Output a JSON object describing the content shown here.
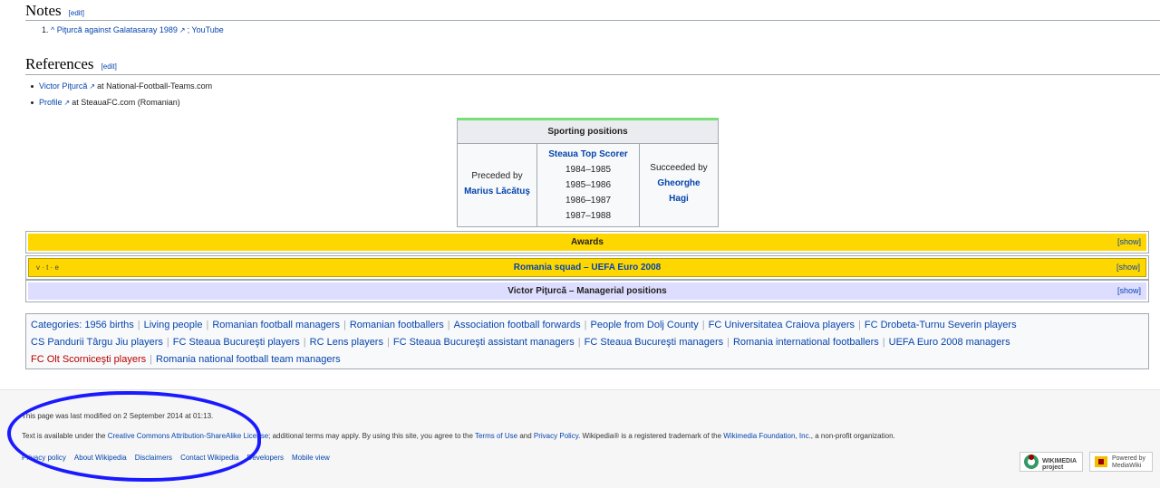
{
  "notes": {
    "heading": "Notes",
    "edit": "[edit]",
    "items": [
      {
        "num": "1.",
        "caret": "^",
        "link": "Piţurcă against Galatasaray 1989",
        "suffix": "; YouTube"
      }
    ]
  },
  "references": {
    "heading": "References",
    "edit": "[edit]",
    "items": [
      {
        "link": "Victor Piţurcă",
        "suffix": "at National-Football-Teams.com"
      },
      {
        "link": "Profile",
        "suffix": "at SteauaFC.com (Romanian)"
      }
    ]
  },
  "succession": {
    "title": "Sporting positions",
    "preceded_label": "Preceded by",
    "preceded_name": "Marius Lăcătuş",
    "position": "Steaua Top Scorer",
    "years": [
      "1984–1985",
      "1985–1986",
      "1986–1987",
      "1987–1988"
    ],
    "succeeded_label": "Succeeded by",
    "succeeded_name_1": "Gheorghe",
    "succeeded_name_2": "Hagi"
  },
  "navboxes": [
    {
      "title": "Awards",
      "show": "[show]",
      "color": "#ffd700"
    },
    {
      "title": "Romania squad – UEFA Euro 2008",
      "show": "[show]",
      "vte": "v · t · e",
      "color": "#ffd700"
    },
    {
      "title": "Victor Piţurcă – Managerial positions",
      "show": "[show]",
      "color": "#ddddff"
    }
  ],
  "categories": {
    "label": "Categories:",
    "items": [
      "1956 births",
      "Living people",
      "Romanian football managers",
      "Romanian footballers",
      "Association football forwards",
      "People from Dolj County",
      "FC Universitatea Craiova players",
      "FC Drobeta-Turnu Severin players",
      "CS Pandurii Târgu Jiu players",
      "FC Steaua Bucureşti players",
      "RC Lens players",
      "FC Steaua Bucureşti assistant managers",
      "FC Steaua Bucureşti managers",
      "Romania international footballers",
      "UEFA Euro 2008 managers",
      "FC Olt Scorniceşti players",
      "Romania national football team managers"
    ]
  },
  "footer": {
    "modified": "This page was last modified on 2 September 2014 at 01:13.",
    "license_pre": "Text is available under the ",
    "license_link": "Creative Commons Attribution-ShareAlike License",
    "license_mid": "; additional terms may apply. By using this site, you agree to the ",
    "terms": "Terms of Use",
    "and": " and ",
    "privacy": "Privacy Policy",
    "license_post": ". Wikipedia® is a registered trademark of the ",
    "foundation": "Wikimedia Foundation, Inc.",
    "license_end": ", a non-profit organization.",
    "links": [
      "Privacy policy",
      "About Wikipedia",
      "Disclaimers",
      "Contact Wikipedia",
      "Developers",
      "Mobile view"
    ],
    "wikimedia_badge": "WIKIMEDIA project",
    "mediawiki_badge": "Powered by MediaWiki"
  },
  "annotation_color": "#1a1aff"
}
